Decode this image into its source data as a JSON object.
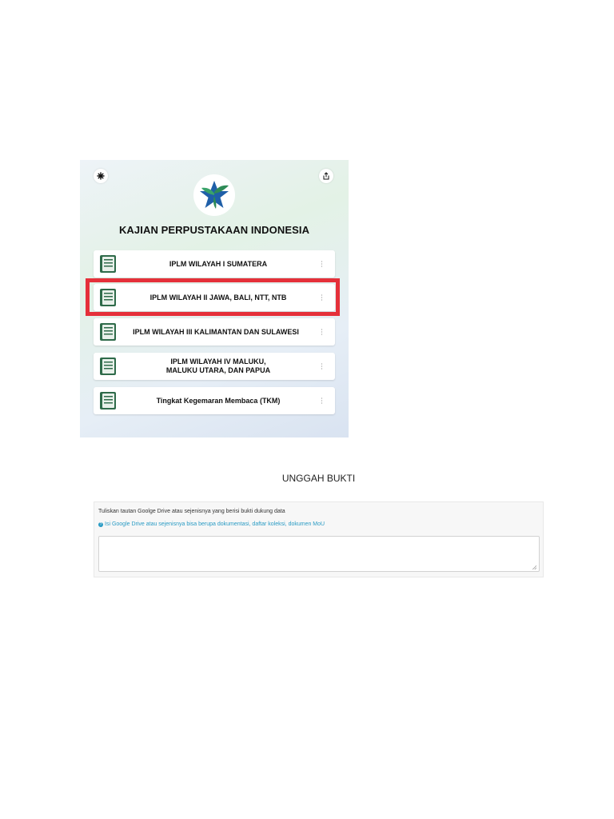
{
  "app": {
    "title": "KAJIAN PERPUSTAKAAN INDONESIA",
    "top_left_icon": "sparkle-icon",
    "top_right_icon": "share-icon",
    "logo_icon": "star-logo",
    "colors": {
      "brand_blue": "#1f5fa8",
      "brand_green": "#2e8b57",
      "highlight_red": "#e5303a",
      "book_green": "#2f6b4a"
    }
  },
  "menu": {
    "items": [
      {
        "label": "IPLM WILAYAH I SUMATERA",
        "icon": "book-icon"
      },
      {
        "label": "IPLM WILAYAH II JAWA, BALI, NTT, NTB",
        "icon": "book-icon",
        "highlighted": true
      },
      {
        "label": "IPLM WILAYAH III KALIMANTAN DAN SULAWESI",
        "icon": "book-icon"
      },
      {
        "label_line1": "IPLM WILAYAH IV MALUKU,",
        "label_line2": "MALUKU UTARA, DAN PAPUA",
        "icon": "book-icon"
      },
      {
        "label": "Tingkat Kegemaran Membaca (TKM)",
        "icon": "book-icon"
      }
    ]
  },
  "upload": {
    "heading": "UNGGAH BUKTI",
    "label": "Tuliskan tautan Goolge Drive atau sejenisnya yang berisi bukti dukung data",
    "help_icon": "question-circle-icon",
    "help_text": "Isi Google Drive atau sejenisnya bisa berupa dokumentasi, daftar koleksi, dokumen MoU",
    "value": "",
    "placeholder": ""
  }
}
